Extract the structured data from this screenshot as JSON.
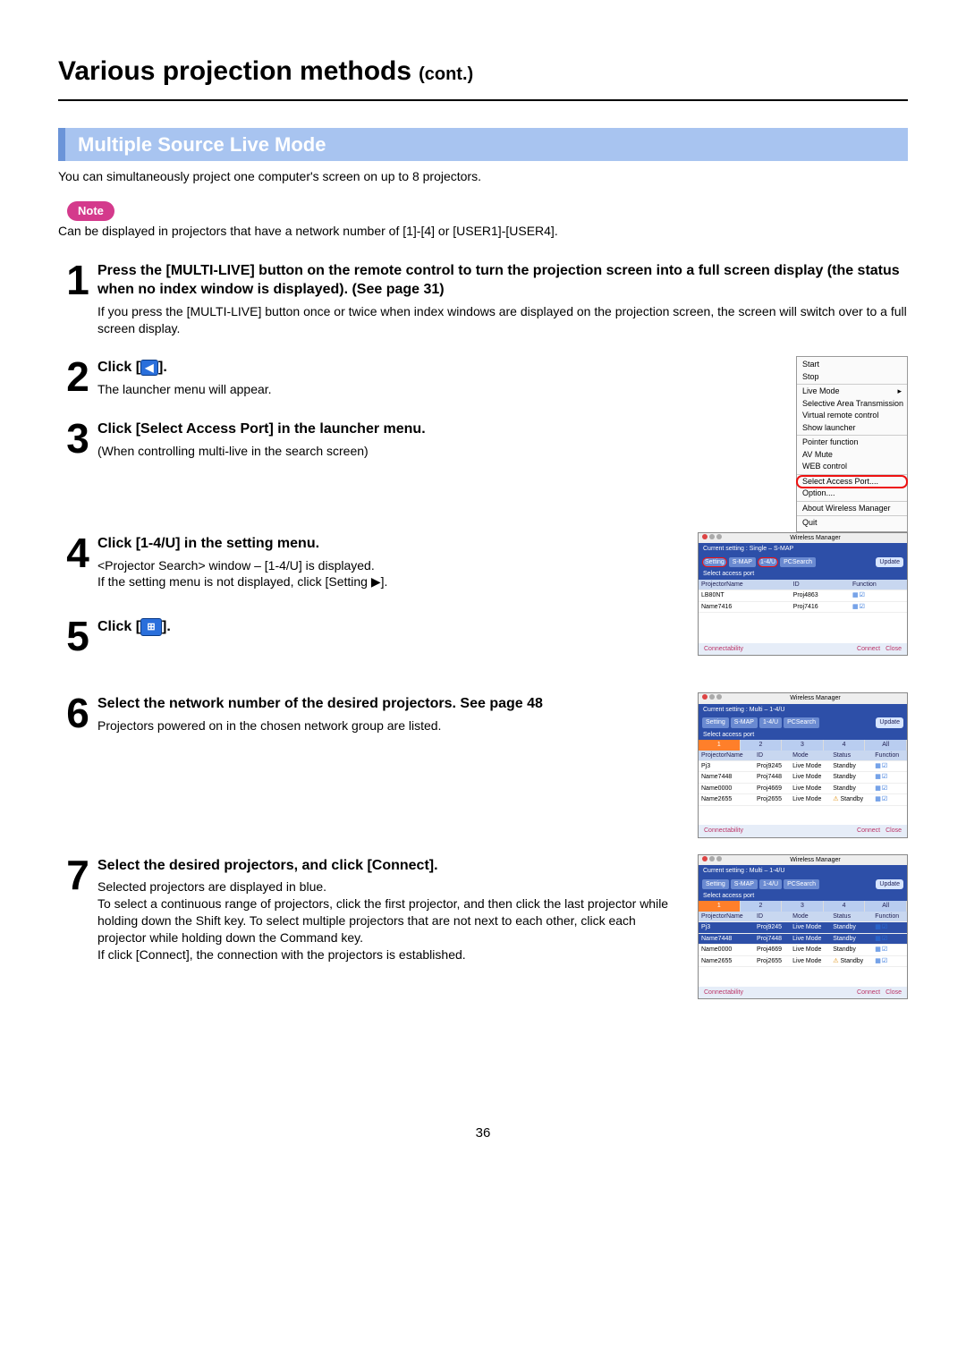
{
  "page": {
    "title": "Various projection methods",
    "cont": "(cont.)",
    "section": "Multiple Source Live Mode",
    "intro": "You can simultaneously project one computer's screen on up to 8 projectors.",
    "note_label": "Note",
    "note_text": "Can be displayed in projectors that have a network number of [1]-[4] or [USER1]-[USER4].",
    "page_number": "36"
  },
  "steps": {
    "s1": {
      "num": "1",
      "head": "Press the [MULTI-LIVE] button on the remote control to turn the projection screen into a full screen display (the status when no index window is displayed). (See page 31)",
      "detail": "If you press the [MULTI-LIVE] button once or twice when index windows are displayed on the projection screen, the screen will switch over to a full screen display."
    },
    "s2": {
      "num": "2",
      "head_pre": "Click [",
      "head_post": "].",
      "detail": "The launcher menu will appear."
    },
    "s3": {
      "num": "3",
      "head": "Click [Select  Access Port] in the launcher menu.",
      "detail": "(When controlling multi-live in the search screen)"
    },
    "s4": {
      "num": "4",
      "head": "Click [1-4/U] in the setting menu.",
      "detail1": "<Projector Search> window – [1-4/U] is displayed.",
      "detail2": "If the setting menu is not displayed, click [Setting ▶]."
    },
    "s5": {
      "num": "5",
      "head_pre": "Click [",
      "head_post": "]."
    },
    "s6": {
      "num": "6",
      "head": "Select the network number of the desired projectors. See page 48",
      "detail": "Projectors powered on in the chosen network group are listed."
    },
    "s7": {
      "num": "7",
      "head": "Select the desired projectors, and click [Connect].",
      "d1": "Selected projectors are displayed in blue.",
      "d2": "To select a continuous range of projectors, click the first projector, and then click the last projector while holding down the Shift key. To select multiple projectors that are not next to each other, click each projector while holding down the Command key.",
      "d3": "If click [Connect], the connection with the projectors is established."
    }
  },
  "launcher_menu": {
    "items": {
      "start": "Start",
      "stop": "Stop",
      "live": "Live Mode",
      "sat": "Selective Area Transmission",
      "vrc": "Virtual remote control",
      "show": "Show launcher",
      "ptr": "Pointer function",
      "av": "AV Mute",
      "web": "WEB control",
      "sap": "Select Access Port....",
      "opt": "Option....",
      "about": "About Wireless Manager",
      "quit": "Quit"
    }
  },
  "wm_shared": {
    "title": "Wireless Manager",
    "tabs": {
      "setting": "Setting",
      "smap": "S-MAP",
      "u": "1-4/U",
      "pc": "PCSearch"
    },
    "update": "Update",
    "sub": "Select access port",
    "headers": {
      "name": "ProjectorName",
      "id": "ID",
      "mode": "Mode",
      "status": "Status",
      "func": "Function"
    },
    "foot": {
      "conn_lbl": "Connectability",
      "connect": "Connect",
      "close": "Close"
    }
  },
  "wm1": {
    "current": "Current setting : Single – S-MAP",
    "rows": [
      {
        "name": "LB80NT",
        "id": "Proj4863"
      },
      {
        "name": "Name7416",
        "id": "Proj7416"
      }
    ]
  },
  "wm2": {
    "current": "Current setting : Multi – 1-4/U",
    "nums": [
      "1",
      "2",
      "3",
      "4",
      "All"
    ],
    "rows": [
      {
        "name": "Pj3",
        "id": "Proj9245",
        "mode": "Live Mode",
        "status": "Standby"
      },
      {
        "name": "Name7448",
        "id": "Proj7448",
        "mode": "Live Mode",
        "status": "Standby"
      },
      {
        "name": "Name0000",
        "id": "Proj4669",
        "mode": "Live Mode",
        "status": "Standby"
      },
      {
        "name": "Name2655",
        "id": "Proj2655",
        "mode": "Live Mode",
        "status": "Standby",
        "warn": true
      }
    ]
  },
  "wm3": {
    "current": "Current setting : Multi – 1-4/U",
    "nums": [
      "1",
      "2",
      "3",
      "4",
      "All"
    ],
    "rows": [
      {
        "name": "Pj3",
        "id": "Proj9245",
        "mode": "Live Mode",
        "status": "Standby",
        "sel": true
      },
      {
        "name": "Name7448",
        "id": "Proj7448",
        "mode": "Live Mode",
        "status": "Standby",
        "sel": true
      },
      {
        "name": "Name0000",
        "id": "Proj4669",
        "mode": "Live Mode",
        "status": "Standby"
      },
      {
        "name": "Name2655",
        "id": "Proj2655",
        "mode": "Live Mode",
        "status": "Standby",
        "warn": true
      }
    ]
  }
}
